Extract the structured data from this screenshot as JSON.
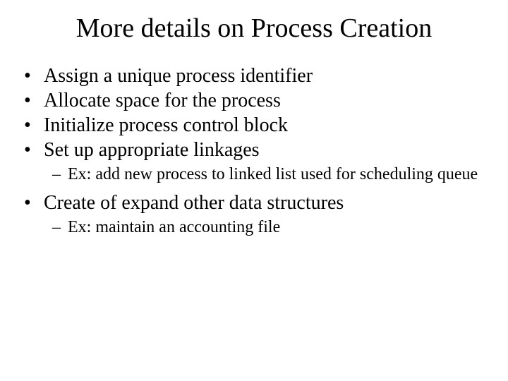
{
  "title": "More details on Process Creation",
  "bullets": {
    "b1": "Assign a unique process identifier",
    "b2": "Allocate space for the process",
    "b3": "Initialize process control block",
    "b4": "Set up appropriate linkages",
    "s4": "Ex: add new process to linked list used for scheduling queue",
    "b5": "Create of expand other data structures",
    "s5": "Ex: maintain an accounting file"
  },
  "markers": {
    "bullet": "•",
    "dash": "–"
  }
}
